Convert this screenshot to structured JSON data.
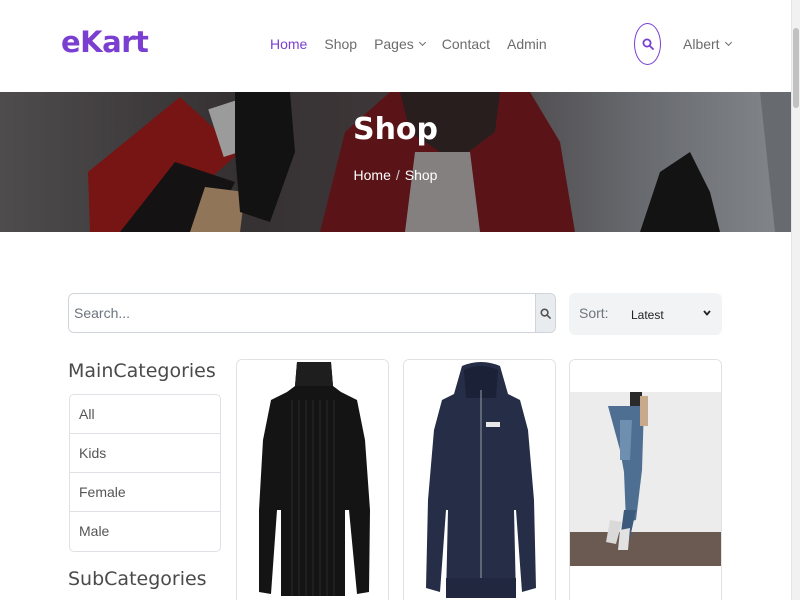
{
  "brand": {
    "logo": "eKart",
    "accent_color": "#7a3fd1"
  },
  "nav": {
    "links": [
      {
        "label": "Home",
        "active": true
      },
      {
        "label": "Shop",
        "active": false
      },
      {
        "label": "Pages",
        "active": false,
        "dropdown": true
      },
      {
        "label": "Contact",
        "active": false
      },
      {
        "label": "Admin",
        "active": false
      }
    ],
    "search_icon": "search-icon",
    "user": {
      "name": "Albert",
      "icon": "chevron-down-icon"
    }
  },
  "hero": {
    "title": "Shop",
    "breadcrumb": {
      "home": "Home",
      "separator": "/",
      "current": "Shop"
    }
  },
  "search": {
    "placeholder": "Search...",
    "value": "",
    "icon": "search-icon"
  },
  "sort": {
    "label": "Sort:",
    "selected": "Latest",
    "icon": "chevron-down-icon"
  },
  "sidebar": {
    "main_heading": "MainCategories",
    "main_categories": [
      "All",
      "Kids",
      "Female",
      "Male"
    ],
    "sub_heading": "SubCategories"
  },
  "products": [
    {
      "image": "black-turtleneck-sweater"
    },
    {
      "image": "navy-zip-hoodie"
    },
    {
      "image": "blue-ripped-jeans"
    }
  ]
}
